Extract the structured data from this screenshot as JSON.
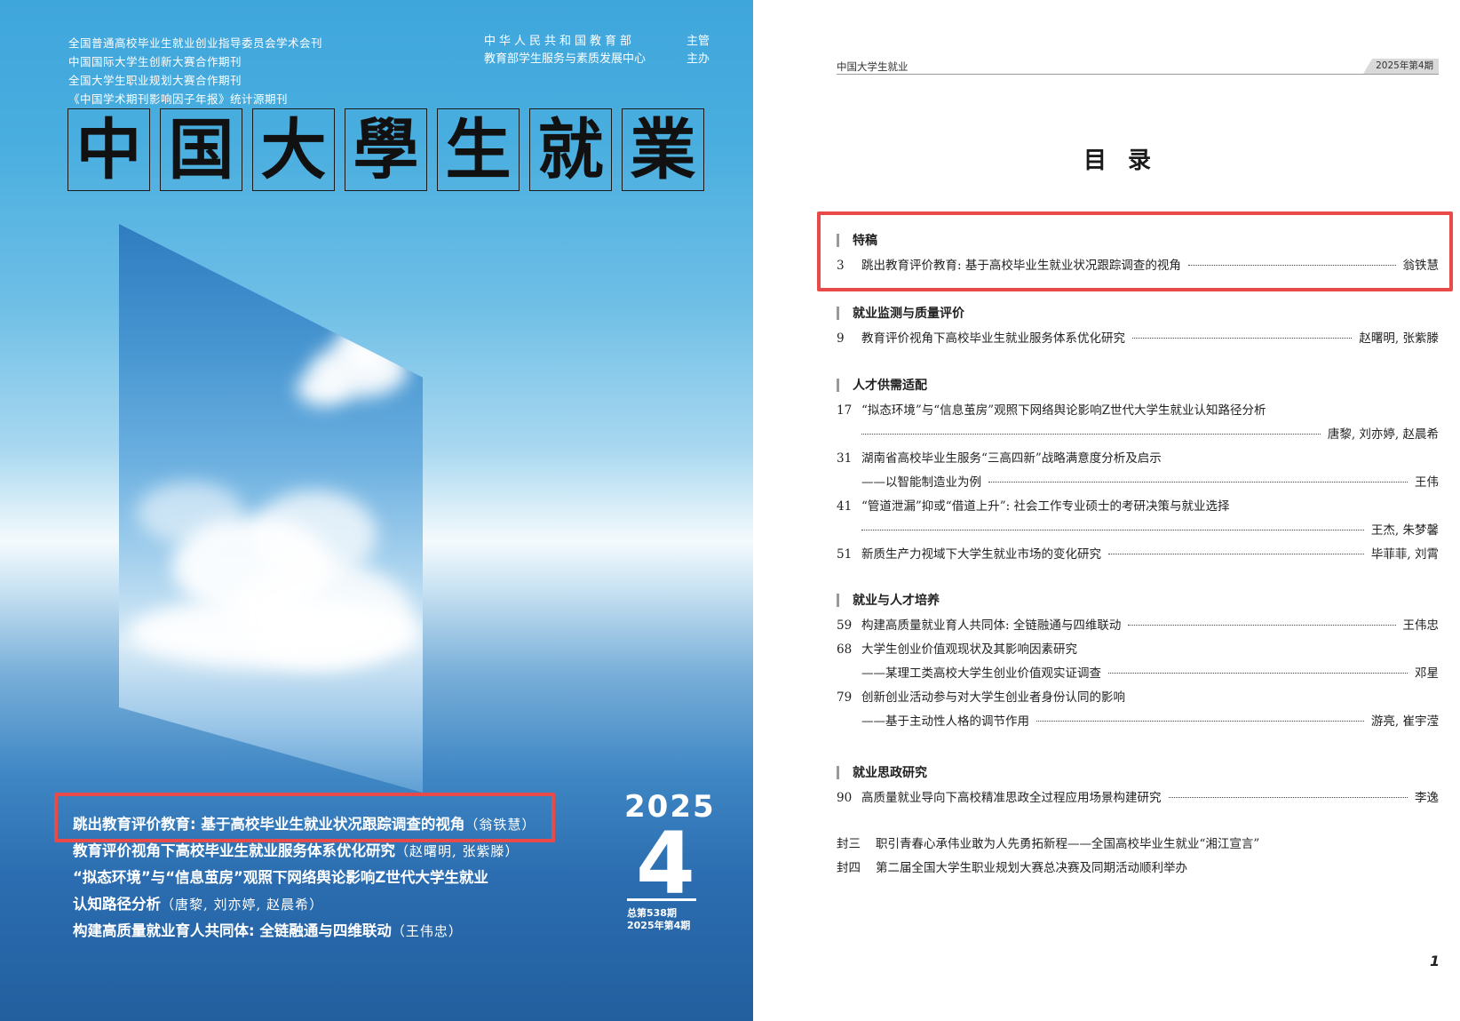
{
  "cover": {
    "affiliations": [
      "全国普通高校毕业生就业创业指导委员会学术会刊",
      "中国国际大学生创新大赛合作期刊",
      "全国大学生职业规划大赛合作期刊",
      "《中国学术期刊影响因子年报》统计源期刊"
    ],
    "sponsors": [
      {
        "org": "中华人民共和国教育部",
        "role": "主管"
      },
      {
        "org": "教育部学生服务与素质发展中心",
        "role": "主办"
      }
    ],
    "title_chars": [
      "中",
      "国",
      "大",
      "學",
      "生",
      "就",
      "業"
    ],
    "year": "2025",
    "issue": "4",
    "issue_total": "总第538期",
    "issue_date": "2025年第4期",
    "articles": [
      {
        "title": "跳出教育评价教育: 基于高校毕业生就业状况跟踪调查的视角",
        "authors": "（翁铁慧）"
      },
      {
        "title": "教育评价视角下高校毕业生就业服务体系优化研究",
        "authors": "（赵曙明, 张紫滕）"
      },
      {
        "title": "“拟态环境”与“信息茧房”观照下网络舆论影响Z世代大学生就业",
        "authors": ""
      },
      {
        "title": "认知路径分析",
        "authors": "（唐黎, 刘亦婷, 赵晨希）"
      },
      {
        "title": "构建高质量就业育人共同体: 全链融通与四维联动",
        "authors": "（王伟忠）"
      }
    ]
  },
  "toc_page": {
    "journal_name": "中国大学生就业",
    "issue_tag": "2025年第4期",
    "title": "目录",
    "sections": [
      {
        "name": "特稿",
        "entries": [
          {
            "page": "3",
            "title": "跳出教育评价教育: 基于高校毕业生就业状况跟踪调查的视角",
            "authors": "翁铁慧"
          }
        ]
      },
      {
        "name": "就业监测与质量评价",
        "entries": [
          {
            "page": "9",
            "title": "教育评价视角下高校毕业生就业服务体系优化研究",
            "authors": "赵曙明, 张紫滕"
          }
        ]
      },
      {
        "name": "人才供需适配",
        "entries": [
          {
            "page": "17",
            "title": "“拟态环境”与“信息茧房”观照下网络舆论影响Z世代大学生就业认知路径分析",
            "authors": ""
          },
          {
            "page": "",
            "title": "",
            "authors": "唐黎, 刘亦婷, 赵晨希"
          },
          {
            "page": "31",
            "title": "湖南省高校毕业生服务“三高四新”战略满意度分析及启示",
            "authors": ""
          },
          {
            "page": "",
            "title": "——以智能制造业为例",
            "authors": "王伟"
          },
          {
            "page": "41",
            "title": "“管道泄漏”抑或“借道上升”: 社会工作专业硕士的考研决策与就业选择",
            "authors": ""
          },
          {
            "page": "",
            "title": "",
            "authors": "王杰, 朱梦馨"
          },
          {
            "page": "51",
            "title": "新质生产力视域下大学生就业市场的变化研究",
            "authors": "毕菲菲, 刘霄"
          }
        ]
      },
      {
        "name": "就业与人才培养",
        "entries": [
          {
            "page": "59",
            "title": "构建高质量就业育人共同体: 全链融通与四维联动",
            "authors": "王伟忠"
          },
          {
            "page": "68",
            "title": "大学生创业价值观现状及其影响因素研究",
            "authors": ""
          },
          {
            "page": "",
            "title": "——某理工类高校大学生创业价值观实证调查",
            "authors": "邓星"
          },
          {
            "page": "79",
            "title": "创新创业活动参与对大学生创业者身份认同的影响",
            "authors": ""
          },
          {
            "page": "",
            "title": "——基于主动性人格的调节作用",
            "authors": "游亮, 崔宇滢"
          }
        ]
      },
      {
        "name": "就业思政研究",
        "entries": [
          {
            "page": "90",
            "title": "高质量就业导向下高校精准思政全过程应用场景构建研究",
            "authors": "李逸"
          }
        ]
      }
    ],
    "backmatter": [
      {
        "label": "封三",
        "text": "职引青春心承伟业敢为人先勇拓新程——全国高校毕业生就业“湘江宣言”"
      },
      {
        "label": "封四",
        "text": "第二届全国大学生职业规划大赛总决赛及同期活动顺利举办"
      }
    ],
    "page_number": "1"
  },
  "colors": {
    "highlight": "#e84a4a",
    "cover_blue": "#2b6db0"
  }
}
